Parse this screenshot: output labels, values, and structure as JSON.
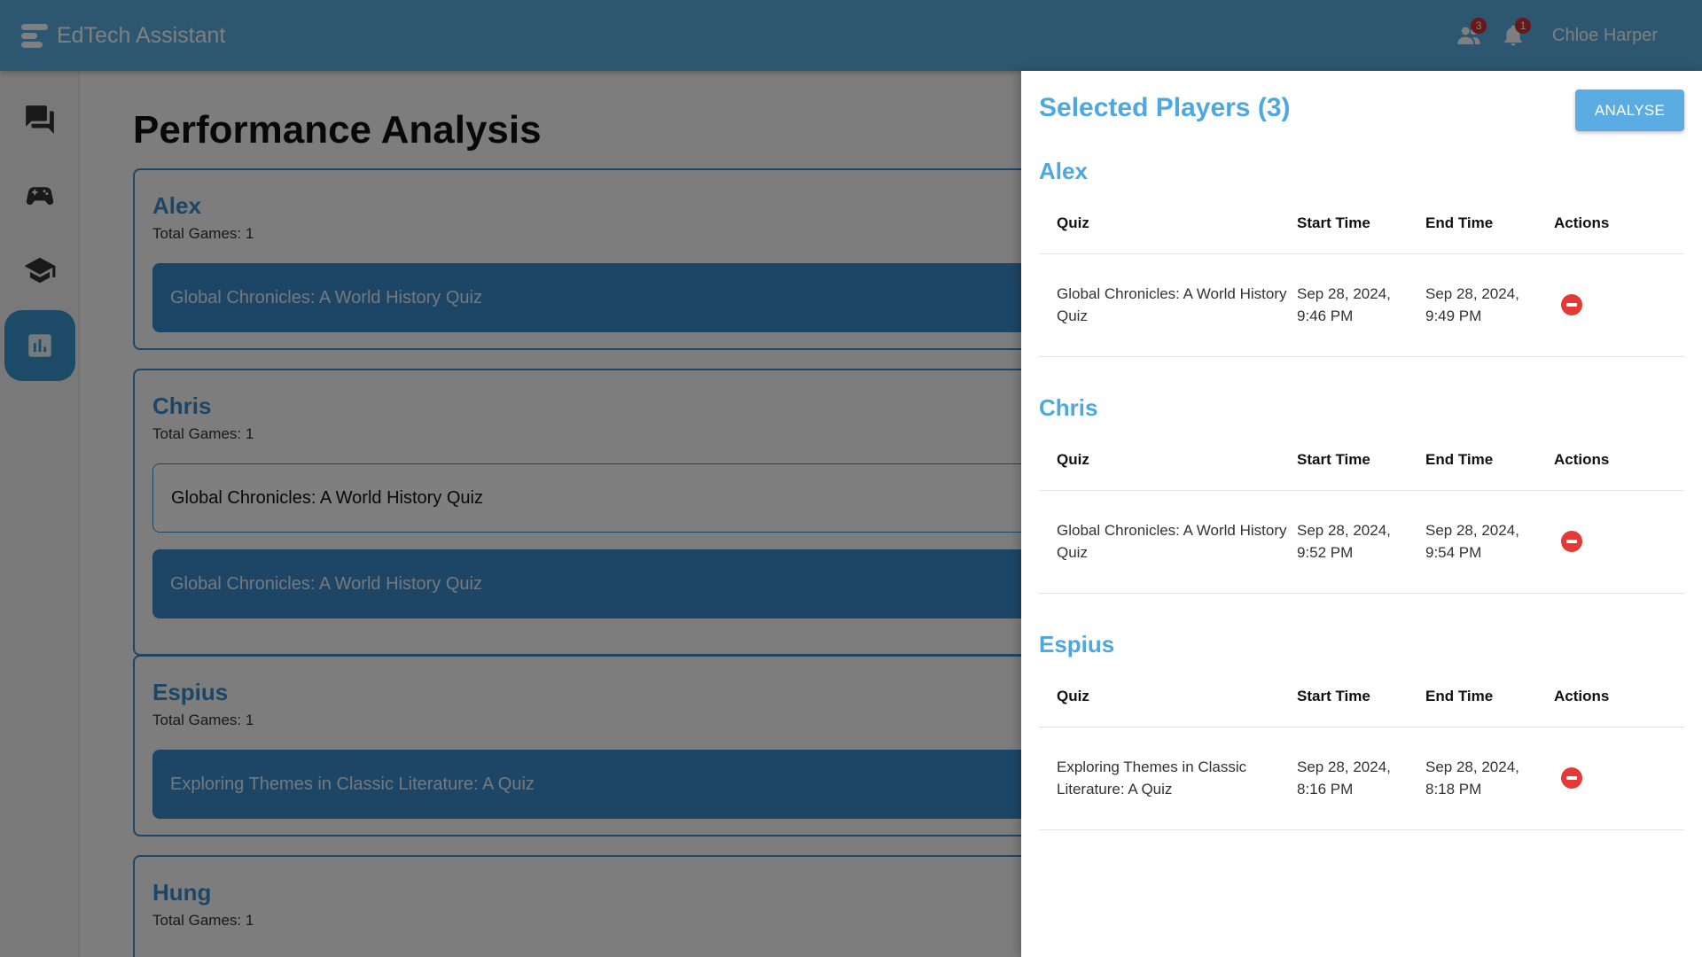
{
  "app": {
    "title": "EdTech Assistant",
    "user_name": "Chloe Harper",
    "contacts_badge": "3",
    "notifications_badge": "1"
  },
  "sidebar": {
    "items": [
      {
        "icon": "chat-icon",
        "active": false
      },
      {
        "icon": "gamepad-icon",
        "active": false
      },
      {
        "icon": "graduation-cap-icon",
        "active": false
      },
      {
        "icon": "bar-chart-icon",
        "active": true
      }
    ]
  },
  "main": {
    "title": "Performance Analysis",
    "players": [
      {
        "name": "Alex",
        "total_games": "Total Games: 1",
        "quizzes": [
          {
            "title": "Global Chronicles: A World History Quiz",
            "selected": true
          }
        ]
      },
      {
        "name": "Chris",
        "total_games": "Total Games: 1",
        "quizzes": [
          {
            "title": "Global Chronicles: A World History Quiz",
            "selected": false
          },
          {
            "title": "Global Chronicles: A World History Quiz",
            "selected": true
          }
        ]
      },
      {
        "name": "Espius",
        "total_games": "Total Games: 1",
        "quizzes": [
          {
            "title": "Exploring Themes in Classic Literature: A Quiz",
            "selected": true
          }
        ]
      },
      {
        "name": "Hung",
        "total_games": "Total Games: 1",
        "quizzes": []
      }
    ]
  },
  "drawer": {
    "title": "Selected Players (3)",
    "analyse_label": "ANALYSE",
    "columns": {
      "quiz": "Quiz",
      "start": "Start Time",
      "end": "End Time",
      "actions": "Actions"
    },
    "players": [
      {
        "name": "Alex",
        "rows": [
          {
            "quiz": "Global Chronicles: A World History Quiz",
            "start": "Sep 28, 2024, 9:46 PM",
            "end": "Sep 28, 2024, 9:49 PM"
          }
        ]
      },
      {
        "name": "Chris",
        "rows": [
          {
            "quiz": "Global Chronicles: A World History Quiz",
            "start": "Sep 28, 2024, 9:52 PM",
            "end": "Sep 28, 2024, 9:54 PM"
          }
        ]
      },
      {
        "name": "Espius",
        "rows": [
          {
            "quiz": "Exploring Themes in Classic Literature: A Quiz",
            "start": "Sep 28, 2024, 8:16 PM",
            "end": "Sep 28, 2024, 8:18 PM"
          }
        ]
      }
    ]
  },
  "colors": {
    "header": "#5aace2",
    "accent": "#3b8dcc",
    "drawer_heading": "#4da8e0",
    "remove": "#e53935"
  }
}
